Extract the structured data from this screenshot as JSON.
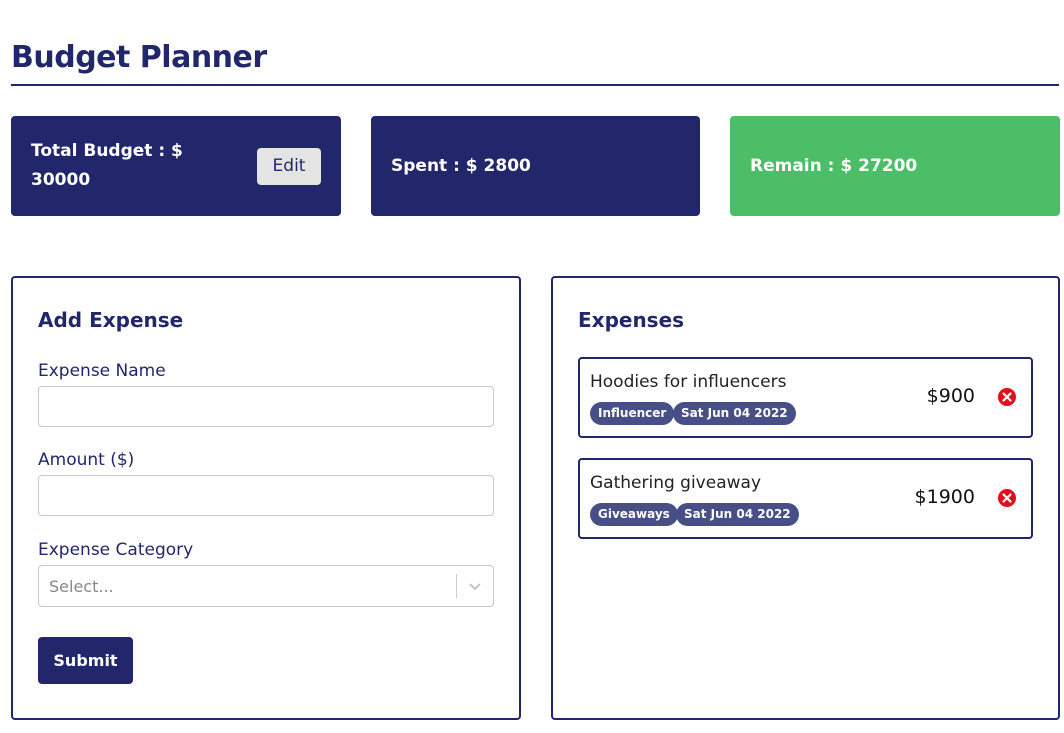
{
  "header": {
    "title": "Budget Planner"
  },
  "stats": {
    "budget_label": "Total Budget : $ 30000",
    "edit_label": "Edit",
    "spent_label": "Spent : $ 2800",
    "remain_label": "Remain : $ 27200"
  },
  "colors": {
    "primary": "#22276b",
    "success": "#4cbe67",
    "tag": "#474f86",
    "danger": "#e0101a"
  },
  "form": {
    "heading": "Add Expense",
    "name_label": "Expense Name",
    "name_value": "",
    "amount_label": "Amount ($)",
    "amount_value": "",
    "category_label": "Expense Category",
    "category_placeholder": "Select...",
    "submit_label": "Submit"
  },
  "expenses": {
    "heading": "Expenses",
    "items": [
      {
        "name": "Hoodies for influencers",
        "category": "Influencer",
        "date": "Sat Jun 04 2022",
        "amount": "$900",
        "icon": "close-circle-icon"
      },
      {
        "name": "Gathering giveaway",
        "category": "Giveaways",
        "date": "Sat Jun 04 2022",
        "amount": "$1900",
        "icon": "close-circle-icon"
      }
    ]
  }
}
